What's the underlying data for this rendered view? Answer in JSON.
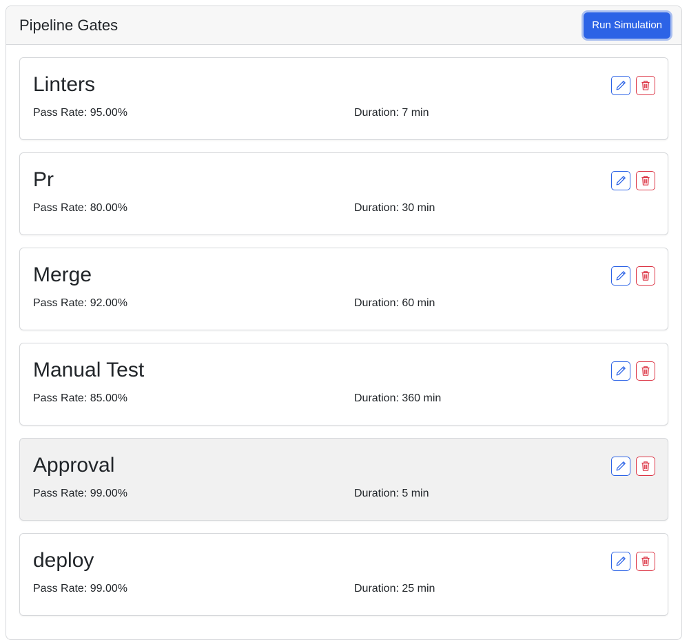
{
  "header": {
    "title": "Pipeline Gates",
    "run_button_label": "Run Simulation"
  },
  "colors": {
    "primary": "#2c63e6",
    "danger": "#dc3545",
    "highlight_bg": "#f1f1f1"
  },
  "gates": [
    {
      "name": "Linters",
      "pass_rate": "Pass Rate: 95.00%",
      "duration": "Duration: 7 min",
      "edit_icon": "pencil-icon",
      "delete_icon": "trash-icon"
    },
    {
      "name": "Pr",
      "pass_rate": "Pass Rate: 80.00%",
      "duration": "Duration: 30 min",
      "edit_icon": "pencil-icon",
      "delete_icon": "trash-icon"
    },
    {
      "name": "Merge",
      "pass_rate": "Pass Rate: 92.00%",
      "duration": "Duration: 60 min",
      "edit_icon": "pencil-icon",
      "delete_icon": "trash-icon"
    },
    {
      "name": "Manual Test",
      "pass_rate": "Pass Rate: 85.00%",
      "duration": "Duration: 360 min",
      "edit_icon": "pencil-icon",
      "delete_icon": "trash-icon"
    },
    {
      "name": "Approval",
      "pass_rate": "Pass Rate: 99.00%",
      "duration": "Duration: 5 min",
      "edit_icon": "pencil-icon",
      "delete_icon": "trash-icon",
      "hovered": true
    },
    {
      "name": "deploy",
      "pass_rate": "Pass Rate: 99.00%",
      "duration": "Duration: 25 min",
      "edit_icon": "pencil-icon",
      "delete_icon": "trash-icon"
    }
  ]
}
